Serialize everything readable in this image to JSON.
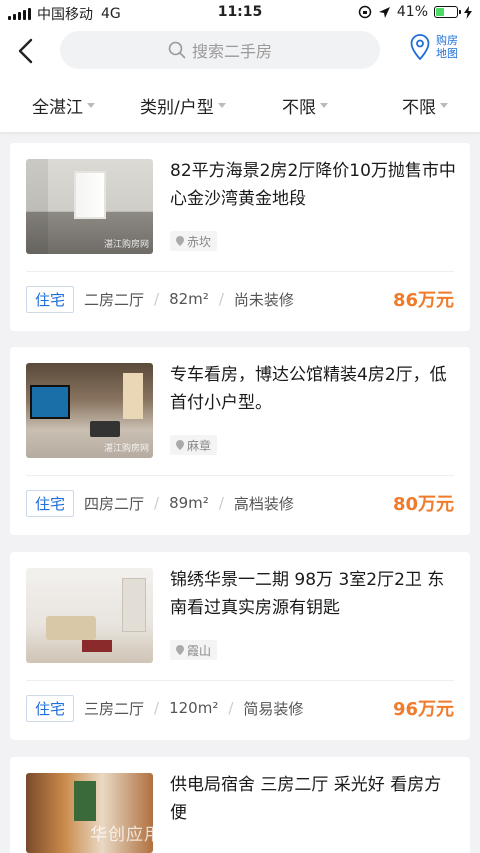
{
  "status": {
    "carrier": "中国移动",
    "network": "4G",
    "time": "11:15",
    "battery": "41%",
    "battery_level": 0.41
  },
  "header": {
    "search_placeholder": "搜索二手房",
    "map_label_line1": "购房",
    "map_label_line2": "地图"
  },
  "filters": [
    {
      "label": "全湛江"
    },
    {
      "label": "类别/户型"
    },
    {
      "label": "不限"
    },
    {
      "label": "不限"
    }
  ],
  "listings": [
    {
      "title": "82平方海景2房2厅降价10万抛售市中心金沙湾黄金地段",
      "location": "赤坎",
      "tag": "住宅",
      "layout": "二房二厅",
      "area": "82m²",
      "decoration": "尚未装修",
      "price": "86万元",
      "photo_watermark": "湛江购房网"
    },
    {
      "title": "专车看房，博达公馆精装4房2厅，低首付小户型。",
      "location": "麻章",
      "tag": "住宅",
      "layout": "四房二厅",
      "area": "89m²",
      "decoration": "高档装修",
      "price": "80万元",
      "photo_watermark": "湛江购房网"
    },
    {
      "title": "锦绣华景一二期 98万 3室2厅2卫 东南看过真实房源有钥匙",
      "location": "霞山",
      "tag": "住宅",
      "layout": "三房二厅",
      "area": "120m²",
      "decoration": "简易装修",
      "price": "96万元"
    },
    {
      "title": "供电局宿舍 三房二厅 采光好 看房方便"
    }
  ],
  "watermark": "华创应用 • HUACHUANGZS.COM",
  "colors": {
    "accent": "#1e6fd9",
    "price": "#f07b2a"
  }
}
